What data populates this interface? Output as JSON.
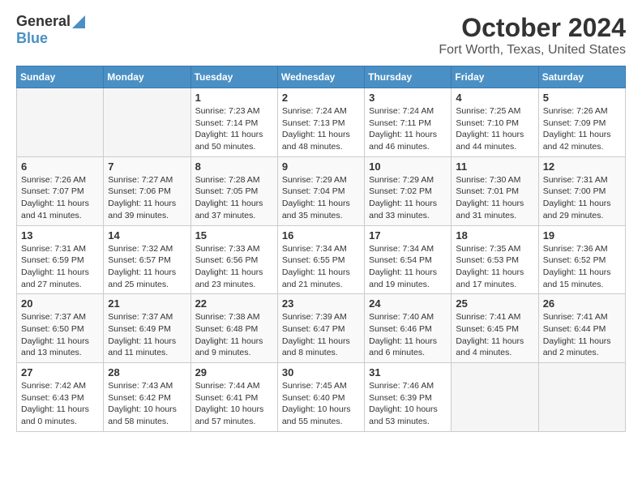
{
  "logo": {
    "general": "General",
    "blue": "Blue"
  },
  "title": "October 2024",
  "subtitle": "Fort Worth, Texas, United States",
  "days_of_week": [
    "Sunday",
    "Monday",
    "Tuesday",
    "Wednesday",
    "Thursday",
    "Friday",
    "Saturday"
  ],
  "weeks": [
    [
      {
        "day": "",
        "info": ""
      },
      {
        "day": "",
        "info": ""
      },
      {
        "day": "1",
        "info": "Sunrise: 7:23 AM\nSunset: 7:14 PM\nDaylight: 11 hours and 50 minutes."
      },
      {
        "day": "2",
        "info": "Sunrise: 7:24 AM\nSunset: 7:13 PM\nDaylight: 11 hours and 48 minutes."
      },
      {
        "day": "3",
        "info": "Sunrise: 7:24 AM\nSunset: 7:11 PM\nDaylight: 11 hours and 46 minutes."
      },
      {
        "day": "4",
        "info": "Sunrise: 7:25 AM\nSunset: 7:10 PM\nDaylight: 11 hours and 44 minutes."
      },
      {
        "day": "5",
        "info": "Sunrise: 7:26 AM\nSunset: 7:09 PM\nDaylight: 11 hours and 42 minutes."
      }
    ],
    [
      {
        "day": "6",
        "info": "Sunrise: 7:26 AM\nSunset: 7:07 PM\nDaylight: 11 hours and 41 minutes."
      },
      {
        "day": "7",
        "info": "Sunrise: 7:27 AM\nSunset: 7:06 PM\nDaylight: 11 hours and 39 minutes."
      },
      {
        "day": "8",
        "info": "Sunrise: 7:28 AM\nSunset: 7:05 PM\nDaylight: 11 hours and 37 minutes."
      },
      {
        "day": "9",
        "info": "Sunrise: 7:29 AM\nSunset: 7:04 PM\nDaylight: 11 hours and 35 minutes."
      },
      {
        "day": "10",
        "info": "Sunrise: 7:29 AM\nSunset: 7:02 PM\nDaylight: 11 hours and 33 minutes."
      },
      {
        "day": "11",
        "info": "Sunrise: 7:30 AM\nSunset: 7:01 PM\nDaylight: 11 hours and 31 minutes."
      },
      {
        "day": "12",
        "info": "Sunrise: 7:31 AM\nSunset: 7:00 PM\nDaylight: 11 hours and 29 minutes."
      }
    ],
    [
      {
        "day": "13",
        "info": "Sunrise: 7:31 AM\nSunset: 6:59 PM\nDaylight: 11 hours and 27 minutes."
      },
      {
        "day": "14",
        "info": "Sunrise: 7:32 AM\nSunset: 6:57 PM\nDaylight: 11 hours and 25 minutes."
      },
      {
        "day": "15",
        "info": "Sunrise: 7:33 AM\nSunset: 6:56 PM\nDaylight: 11 hours and 23 minutes."
      },
      {
        "day": "16",
        "info": "Sunrise: 7:34 AM\nSunset: 6:55 PM\nDaylight: 11 hours and 21 minutes."
      },
      {
        "day": "17",
        "info": "Sunrise: 7:34 AM\nSunset: 6:54 PM\nDaylight: 11 hours and 19 minutes."
      },
      {
        "day": "18",
        "info": "Sunrise: 7:35 AM\nSunset: 6:53 PM\nDaylight: 11 hours and 17 minutes."
      },
      {
        "day": "19",
        "info": "Sunrise: 7:36 AM\nSunset: 6:52 PM\nDaylight: 11 hours and 15 minutes."
      }
    ],
    [
      {
        "day": "20",
        "info": "Sunrise: 7:37 AM\nSunset: 6:50 PM\nDaylight: 11 hours and 13 minutes."
      },
      {
        "day": "21",
        "info": "Sunrise: 7:37 AM\nSunset: 6:49 PM\nDaylight: 11 hours and 11 minutes."
      },
      {
        "day": "22",
        "info": "Sunrise: 7:38 AM\nSunset: 6:48 PM\nDaylight: 11 hours and 9 minutes."
      },
      {
        "day": "23",
        "info": "Sunrise: 7:39 AM\nSunset: 6:47 PM\nDaylight: 11 hours and 8 minutes."
      },
      {
        "day": "24",
        "info": "Sunrise: 7:40 AM\nSunset: 6:46 PM\nDaylight: 11 hours and 6 minutes."
      },
      {
        "day": "25",
        "info": "Sunrise: 7:41 AM\nSunset: 6:45 PM\nDaylight: 11 hours and 4 minutes."
      },
      {
        "day": "26",
        "info": "Sunrise: 7:41 AM\nSunset: 6:44 PM\nDaylight: 11 hours and 2 minutes."
      }
    ],
    [
      {
        "day": "27",
        "info": "Sunrise: 7:42 AM\nSunset: 6:43 PM\nDaylight: 11 hours and 0 minutes."
      },
      {
        "day": "28",
        "info": "Sunrise: 7:43 AM\nSunset: 6:42 PM\nDaylight: 10 hours and 58 minutes."
      },
      {
        "day": "29",
        "info": "Sunrise: 7:44 AM\nSunset: 6:41 PM\nDaylight: 10 hours and 57 minutes."
      },
      {
        "day": "30",
        "info": "Sunrise: 7:45 AM\nSunset: 6:40 PM\nDaylight: 10 hours and 55 minutes."
      },
      {
        "day": "31",
        "info": "Sunrise: 7:46 AM\nSunset: 6:39 PM\nDaylight: 10 hours and 53 minutes."
      },
      {
        "day": "",
        "info": ""
      },
      {
        "day": "",
        "info": ""
      }
    ]
  ]
}
